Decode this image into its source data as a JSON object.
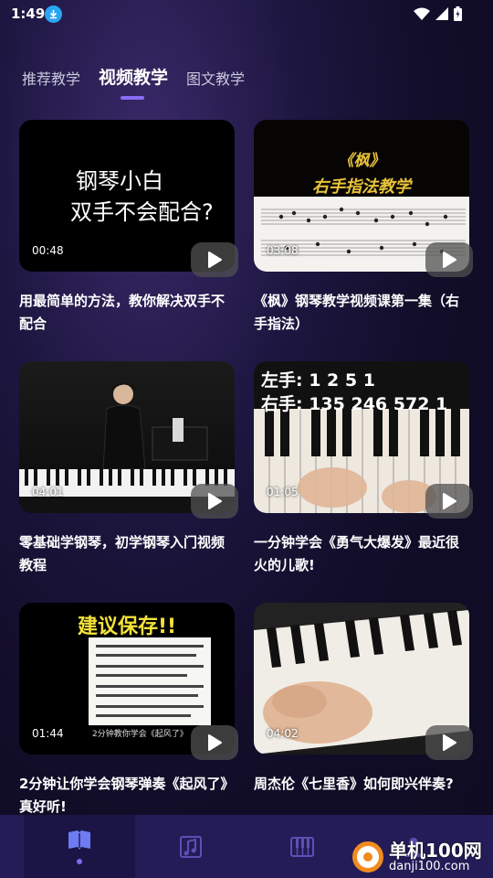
{
  "status": {
    "time": "1:49"
  },
  "tabs": [
    {
      "label": "推荐教学"
    },
    {
      "label": "视频教学"
    },
    {
      "label": "图文教学"
    }
  ],
  "videos": [
    {
      "duration": "00:48",
      "title": "用最简单的方法，教你解决双手不配合",
      "thumb_text": [
        "钢琴小白",
        "双手不会配合?"
      ]
    },
    {
      "duration": "03:08",
      "title": "《枫》钢琴教学视频课第一集（右手指法）",
      "thumb_text": [
        "《枫》",
        "右手指法教学"
      ]
    },
    {
      "duration": "04:01",
      "title": "零基础学钢琴，初学钢琴入门视频教程"
    },
    {
      "duration": "01:05",
      "title": "一分钟学会《勇气大爆发》最近很火的儿歌!",
      "thumb_text": [
        "左手: 1   2   5   1",
        "右手: 135 246 572 1"
      ]
    },
    {
      "duration": "01:44",
      "title": "2分钟让你学会钢琴弹奏《起风了》真好听!",
      "thumb_text": [
        "建议保存!!",
        "2分钟教你学会《起风了》"
      ]
    },
    {
      "duration": "04:02",
      "title": "周杰伦《七里香》如何即兴伴奏?"
    }
  ],
  "nav": [
    {
      "icon": "book-icon"
    },
    {
      "icon": "sheet-music-icon"
    },
    {
      "icon": "piano-icon"
    },
    {
      "icon": "user-icon"
    }
  ],
  "watermark": {
    "name": "单机100网",
    "url": "danji100.com"
  }
}
